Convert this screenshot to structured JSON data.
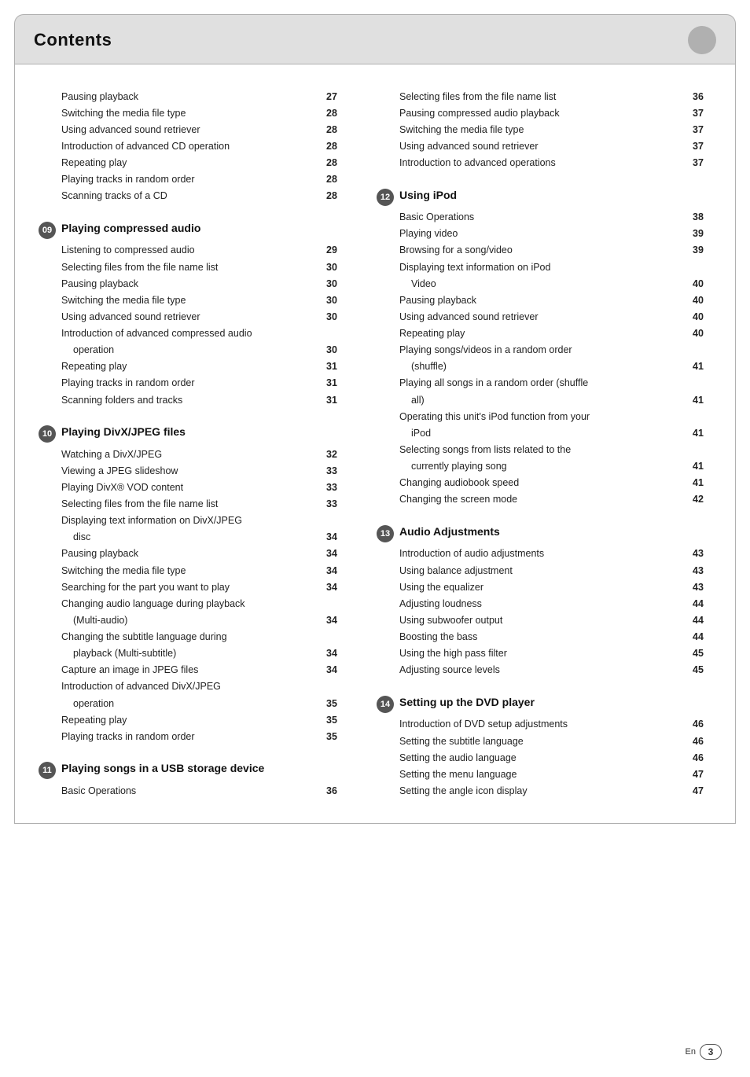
{
  "header": {
    "title": "Contents",
    "page_label": "En",
    "page_number": "3"
  },
  "left_col": {
    "top_entries": [
      {
        "text": "Pausing playback",
        "num": "27"
      },
      {
        "text": "Switching the media file type",
        "num": "28"
      },
      {
        "text": "Using advanced sound retriever",
        "num": "28"
      },
      {
        "text": "Introduction of advanced CD operation",
        "num": "28"
      },
      {
        "text": "Repeating play",
        "num": "28"
      },
      {
        "text": "Playing tracks in random order",
        "num": "28"
      },
      {
        "text": "Scanning tracks of a CD",
        "num": "28"
      }
    ],
    "sections": [
      {
        "id": "09",
        "title": "Playing compressed audio",
        "entries": [
          {
            "text": "Listening to compressed audio",
            "num": "29",
            "indent": false
          },
          {
            "text": "Selecting files from the file name list",
            "num": "30",
            "indent": false
          },
          {
            "text": "Pausing playback",
            "num": "30",
            "indent": false
          },
          {
            "text": "Switching the media file type",
            "num": "30",
            "indent": false
          },
          {
            "text": "Using advanced sound retriever",
            "num": "30",
            "indent": false
          },
          {
            "text": "Introduction of advanced compressed audio",
            "num": "",
            "indent": false
          },
          {
            "text": "operation",
            "num": "30",
            "indent": true
          },
          {
            "text": "Repeating play",
            "num": "31",
            "indent": false
          },
          {
            "text": "Playing tracks in random order",
            "num": "31",
            "indent": false
          },
          {
            "text": "Scanning folders and tracks",
            "num": "31",
            "indent": false
          }
        ]
      },
      {
        "id": "10",
        "title": "Playing DivX/JPEG files",
        "entries": [
          {
            "text": "Watching a DivX/JPEG",
            "num": "32",
            "indent": false
          },
          {
            "text": "Viewing a JPEG slideshow",
            "num": "33",
            "indent": false
          },
          {
            "text": "Playing DivX® VOD content",
            "num": "33",
            "indent": false
          },
          {
            "text": "Selecting files from the file name list",
            "num": "33",
            "indent": false
          },
          {
            "text": "Displaying text information on DivX/JPEG",
            "num": "",
            "indent": false
          },
          {
            "text": "disc",
            "num": "34",
            "indent": true
          },
          {
            "text": "Pausing playback",
            "num": "34",
            "indent": false
          },
          {
            "text": "Switching the media file type",
            "num": "34",
            "indent": false
          },
          {
            "text": "Searching for the part you want to play",
            "num": "34",
            "indent": false
          },
          {
            "text": "Changing audio language during playback",
            "num": "",
            "indent": false
          },
          {
            "text": "(Multi-audio)",
            "num": "34",
            "indent": true
          },
          {
            "text": "Changing the subtitle language during",
            "num": "",
            "indent": false
          },
          {
            "text": "playback (Multi-subtitle)",
            "num": "34",
            "indent": true
          },
          {
            "text": "Capture an image in JPEG files",
            "num": "34",
            "indent": false
          },
          {
            "text": "Introduction of advanced DivX/JPEG",
            "num": "",
            "indent": false
          },
          {
            "text": "operation",
            "num": "35",
            "indent": true
          },
          {
            "text": "Repeating play",
            "num": "35",
            "indent": false
          },
          {
            "text": "Playing tracks in random order",
            "num": "35",
            "indent": false
          }
        ]
      },
      {
        "id": "11",
        "title": "Playing songs in a USB storage device",
        "entries": [
          {
            "text": "Basic Operations",
            "num": "36",
            "indent": false
          }
        ]
      }
    ]
  },
  "right_col": {
    "top_entries": [
      {
        "text": "Selecting files from the file name list",
        "num": "36"
      },
      {
        "text": "Pausing compressed audio playback",
        "num": "37"
      },
      {
        "text": "Switching the media file type",
        "num": "37"
      },
      {
        "text": "Using advanced sound retriever",
        "num": "37"
      },
      {
        "text": "Introduction to advanced operations",
        "num": "37"
      }
    ],
    "sections": [
      {
        "id": "12",
        "title": "Using iPod",
        "entries": [
          {
            "text": "Basic Operations",
            "num": "38",
            "indent": false
          },
          {
            "text": "Playing video",
            "num": "39",
            "indent": false
          },
          {
            "text": "Browsing for a song/video",
            "num": "39",
            "indent": false
          },
          {
            "text": "Displaying text information on iPod",
            "num": "",
            "indent": false
          },
          {
            "text": "Video",
            "num": "40",
            "indent": true
          },
          {
            "text": "Pausing playback",
            "num": "40",
            "indent": false
          },
          {
            "text": "Using advanced sound retriever",
            "num": "40",
            "indent": false
          },
          {
            "text": "Repeating play",
            "num": "40",
            "indent": false
          },
          {
            "text": "Playing songs/videos in a random order",
            "num": "",
            "indent": false
          },
          {
            "text": "(shuffle)",
            "num": "41",
            "indent": true
          },
          {
            "text": "Playing all songs in a random order (shuffle",
            "num": "",
            "indent": false
          },
          {
            "text": "all)",
            "num": "41",
            "indent": true
          },
          {
            "text": "Operating this unit's iPod function from your",
            "num": "",
            "indent": false
          },
          {
            "text": "iPod",
            "num": "41",
            "indent": true
          },
          {
            "text": "Selecting songs from lists related to the",
            "num": "",
            "indent": false
          },
          {
            "text": "currently playing song",
            "num": "41",
            "indent": true
          },
          {
            "text": "Changing audiobook speed",
            "num": "41",
            "indent": false
          },
          {
            "text": "Changing the screen mode",
            "num": "42",
            "indent": false
          }
        ]
      },
      {
        "id": "13",
        "title": "Audio Adjustments",
        "entries": [
          {
            "text": "Introduction of audio adjustments",
            "num": "43",
            "indent": false
          },
          {
            "text": "Using balance adjustment",
            "num": "43",
            "indent": false
          },
          {
            "text": "Using the equalizer",
            "num": "43",
            "indent": false
          },
          {
            "text": "Adjusting loudness",
            "num": "44",
            "indent": false
          },
          {
            "text": "Using subwoofer output",
            "num": "44",
            "indent": false
          },
          {
            "text": "Boosting the bass",
            "num": "44",
            "indent": false
          },
          {
            "text": "Using the high pass filter",
            "num": "45",
            "indent": false
          },
          {
            "text": "Adjusting source levels",
            "num": "45",
            "indent": false
          }
        ]
      },
      {
        "id": "14",
        "title": "Setting up the DVD player",
        "entries": [
          {
            "text": "Introduction of DVD setup adjustments",
            "num": "46",
            "indent": false
          },
          {
            "text": "Setting the subtitle language",
            "num": "46",
            "indent": false
          },
          {
            "text": "Setting the audio language",
            "num": "46",
            "indent": false
          },
          {
            "text": "Setting the menu language",
            "num": "47",
            "indent": false
          },
          {
            "text": "Setting the angle icon display",
            "num": "47",
            "indent": false
          }
        ]
      }
    ]
  }
}
